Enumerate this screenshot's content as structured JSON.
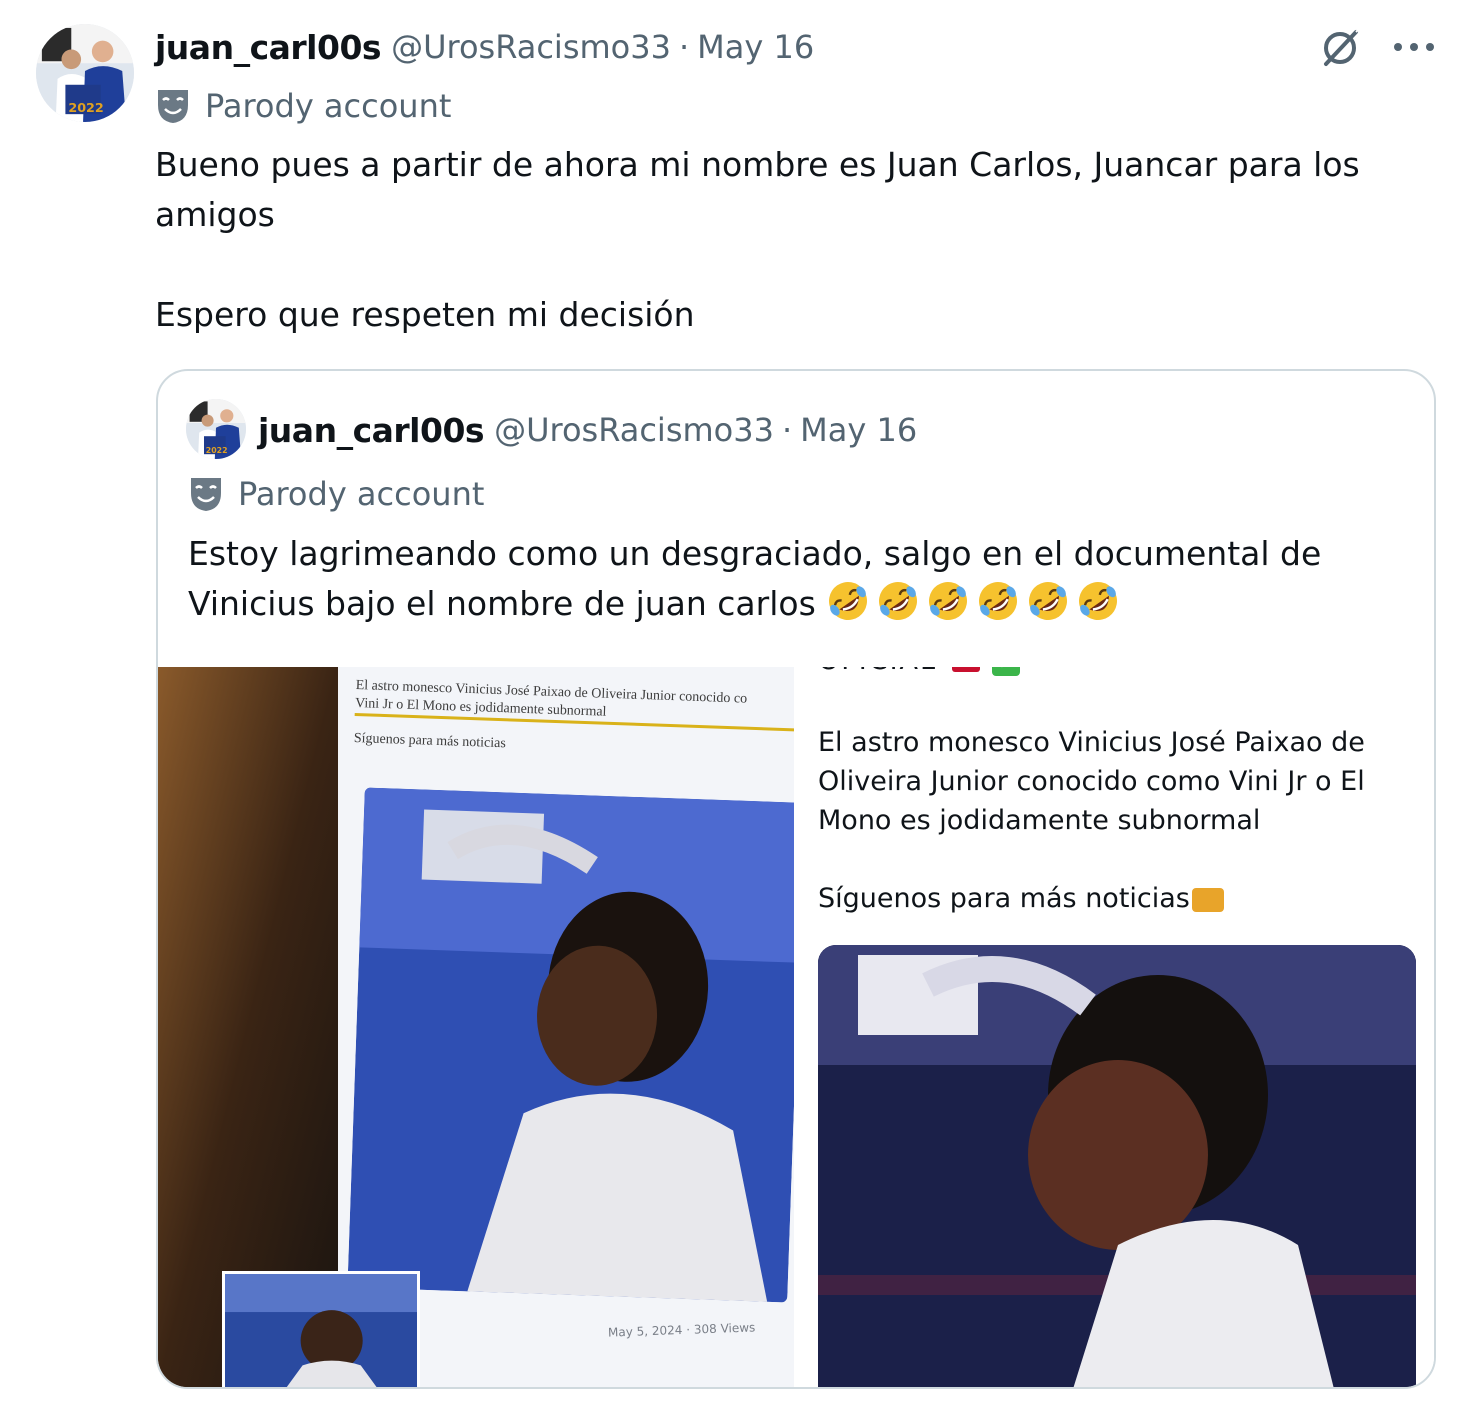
{
  "tweet": {
    "author_name": "juan_carl00s",
    "handle": "@UrosRacismo33",
    "separator": "·",
    "date": "May 16",
    "badge": "Parody account",
    "text_line1": "Bueno pues a partir de ahora mi nombre es Juan Carlos, Juancar para los amigos",
    "text_line2": "Espero que respeten mi decisión"
  },
  "icons": {
    "grok": "grok-icon",
    "more": "more-icon",
    "parody_mask": "theater-mask-icon",
    "laughing_emoji": "rolling-on-floor-laughing-emoji",
    "radio_emoji": "radio-emoji",
    "check_emoji": "check-mark-emoji"
  },
  "quote": {
    "author_name": "juan_carl00s",
    "handle": "@UrosRacismo33",
    "separator": "·",
    "date": "May 16",
    "badge": "Parody account",
    "text": "Estoy lagrimeando como un desgraciado, salgo en el documental de Vinicius bajo el nombre de juan carlos",
    "emoji_count": 6
  },
  "media": {
    "left_photo": {
      "screen_caption_1": "El astro monesco Vinicius José Paixao de Oliveira Junior conocido co",
      "screen_caption_2": "Vini Jr o El Mono es jodidamente subnormal",
      "screen_caption_3": "Síguenos para más noticias",
      "screen_footer": "May 5, 2024 · 308 Views"
    },
    "right_panel": {
      "clipped_heading": "OFICIAL",
      "paragraph": "El astro monesco Vinicius José Paixao de Oliveira Junior conocido como Vini Jr o El Mono es jodidamente subnormal",
      "follow_line": "Síguenos para más noticias"
    }
  },
  "colors": {
    "text_primary": "#0f1419",
    "text_secondary": "#536471",
    "border": "#cfd9de"
  }
}
